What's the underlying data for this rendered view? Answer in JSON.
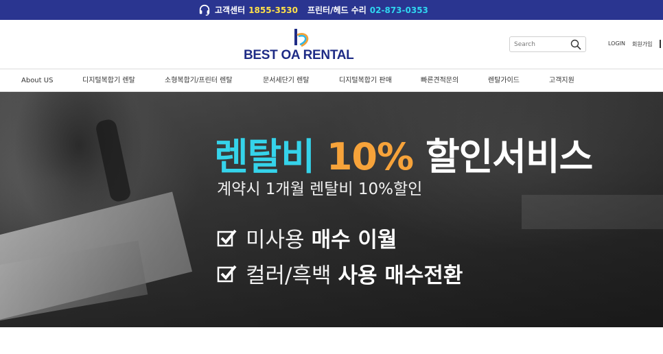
{
  "topbar": {
    "headset_icon": "headset-icon",
    "center_label": "고객센터",
    "center_number": "1855-3530",
    "printer_label": "프린터/헤드 수리",
    "printer_number": "02-873-0353",
    "colors": {
      "bg": "#2a3590",
      "yellow": "#ffe14a",
      "cyan": "#2fd6f0"
    }
  },
  "header": {
    "logo_text": "BEST OA RENTAL",
    "search_placeholder": "Search",
    "search_icon": "search-icon",
    "login": "LOGIN",
    "signup": "회원가입"
  },
  "nav": {
    "items": [
      {
        "label": "About US"
      },
      {
        "label": "디지털복합기 렌탈"
      },
      {
        "label": "소형복합기/프린터 렌탈"
      },
      {
        "label": "문서세단기 렌탈"
      },
      {
        "label": "디지털복합기 판매"
      },
      {
        "label": "빠른견적문의"
      },
      {
        "label": "렌탈가이드"
      },
      {
        "label": "고객지원"
      }
    ]
  },
  "banner": {
    "headline_part1": "렌탈비",
    "headline_part2": "10%",
    "headline_part3": "할인서비스",
    "subline": "계약시 1개월 렌탈비 10%할인",
    "check_icon": "checkbox-checked-icon",
    "rows": [
      {
        "light": "미사용",
        "bold": "매수 이월"
      },
      {
        "light": "컬러/흑백",
        "bold": "사용 매수전환"
      }
    ],
    "colors": {
      "cyan": "#35d3ea",
      "orange": "#f7a33a"
    }
  }
}
